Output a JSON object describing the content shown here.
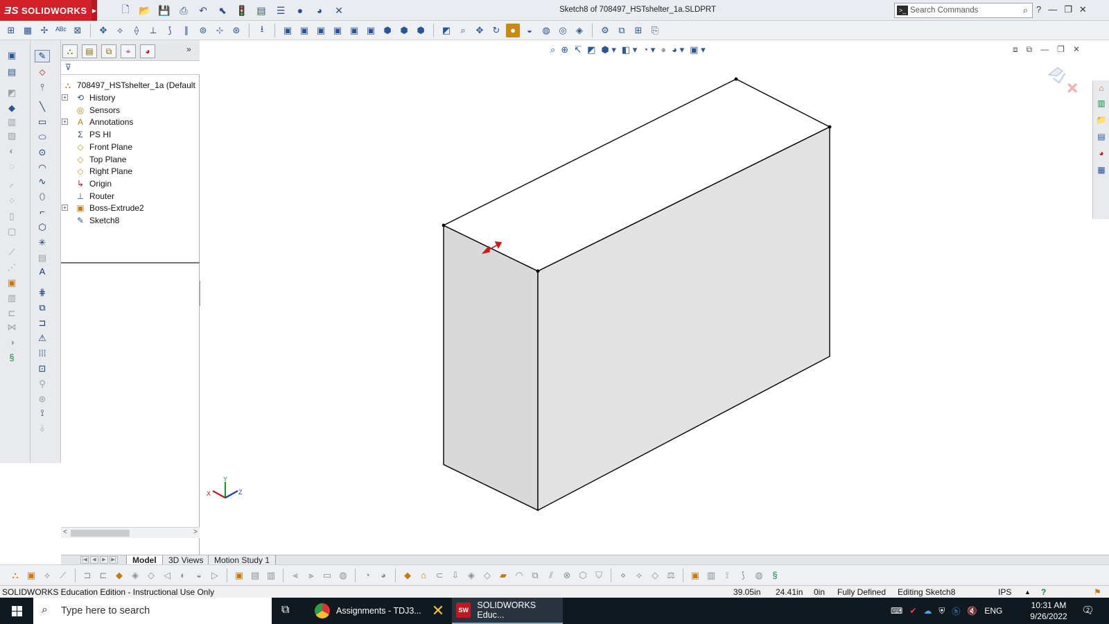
{
  "app": {
    "logo_text": "SOLIDWORKS",
    "window_title": "Sketch8 of 708497_HSTshelter_1a.SLDPRT",
    "search_placeholder": "Search Commands"
  },
  "feature_tree": {
    "root": "708497_HSTshelter_1a  (Default",
    "items": [
      {
        "label": "History",
        "icon": "history-icon",
        "expandable": true
      },
      {
        "label": "Sensors",
        "icon": "sensor-icon",
        "expandable": false
      },
      {
        "label": "Annotations",
        "icon": "annotation-icon",
        "expandable": true
      },
      {
        "label": "PS HI",
        "icon": "equations-icon",
        "expandable": false
      },
      {
        "label": "Front Plane",
        "icon": "plane-icon",
        "expandable": false
      },
      {
        "label": "Top Plane",
        "icon": "plane-icon",
        "expandable": false
      },
      {
        "label": "Right Plane",
        "icon": "plane-icon",
        "expandable": false
      },
      {
        "label": "Origin",
        "icon": "origin-icon",
        "expandable": false
      },
      {
        "label": "Router",
        "icon": "router-icon",
        "expandable": false
      },
      {
        "label": "Boss-Extrude2",
        "icon": "extrude-icon",
        "expandable": true
      },
      {
        "label": "Sketch8",
        "icon": "sketch-icon",
        "expandable": false
      }
    ]
  },
  "view_tabs": [
    {
      "label": "Model",
      "active": true
    },
    {
      "label": "3D Views",
      "active": false
    },
    {
      "label": "Motion Study 1",
      "active": false
    }
  ],
  "triad_labels": {
    "x": "X",
    "y": "Y",
    "z": "Z"
  },
  "status": {
    "edition": "SOLIDWORKS Education Edition - Instructional Use Only",
    "x": "39.05in",
    "y": "24.41in",
    "z": "0in",
    "state": "Fully Defined",
    "mode": "Editing Sketch8",
    "units": "IPS"
  },
  "taskbar": {
    "search_placeholder": "Type here to search",
    "apps": [
      {
        "label": "Assignments - TDJ3...",
        "icon": "chrome-icon"
      },
      {
        "label": "SOLIDWORKS Educ...",
        "icon": "solidworks-icon"
      }
    ],
    "language": "ENG",
    "time": "10:31 AM",
    "date": "9/26/2022",
    "notifications": "2"
  },
  "colors": {
    "brand_red": "#d0202a",
    "face_front": "#d9d9d9",
    "face_side": "#e2e2e2",
    "edge": "#000000"
  }
}
